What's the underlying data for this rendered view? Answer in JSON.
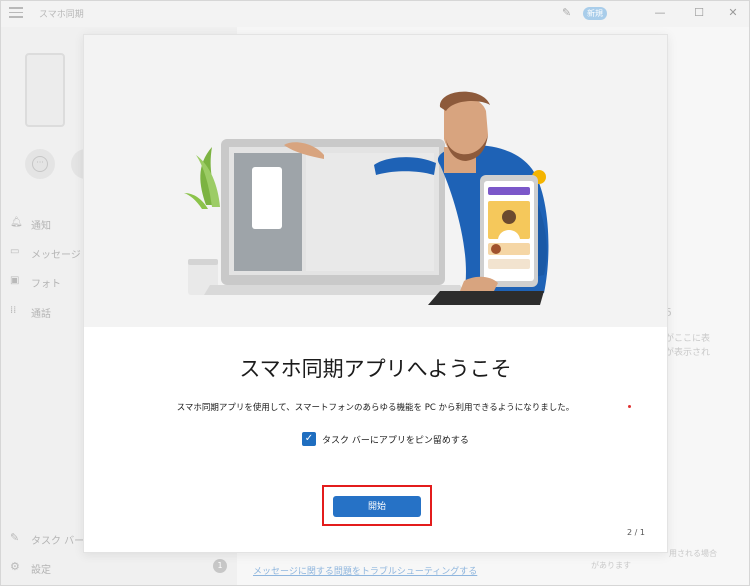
{
  "titlebar": {
    "app_title": "スマホ同期",
    "new_badge": "新規",
    "minimize": "—",
    "maximize": "☐",
    "close": "✕",
    "icons": [
      "hamburger-icon",
      "pen-icon"
    ]
  },
  "sidebar": {
    "nav": [
      {
        "icon": "bell-icon",
        "label": "通知"
      },
      {
        "icon": "chat-icon",
        "label": "メッセージ"
      },
      {
        "icon": "photo-icon",
        "label": "フォト"
      },
      {
        "icon": "keypad-icon",
        "label": "通話"
      }
    ],
    "pin_label": "タスク バーにア",
    "settings_label": "設定",
    "settings_count": "1"
  },
  "background": {
    "right_text_1": "5",
    "right_text_2": "がここに表",
    "right_text_3": "が表示され",
    "bottom_text_1": "用される場合",
    "bottom_text_2": "があります",
    "troubleshoot_link": "メッセージに関する問題をトラブルシューティングする"
  },
  "dialog": {
    "title": "スマホ同期アプリへようこそ",
    "description": "スマホ同期アプリを使用して、スマートフォンのあらゆる機能を PC から利用できるようになりました。",
    "pin_checkbox_label": "タスク バーにアプリをピン留めする",
    "pin_checked": true,
    "checkmark": "✓",
    "start_button": "開始",
    "page_indicator": "2 / 1"
  },
  "colors": {
    "accent": "#2672c6",
    "highlight": "#e31c1c",
    "badge": "#a9cdea"
  }
}
